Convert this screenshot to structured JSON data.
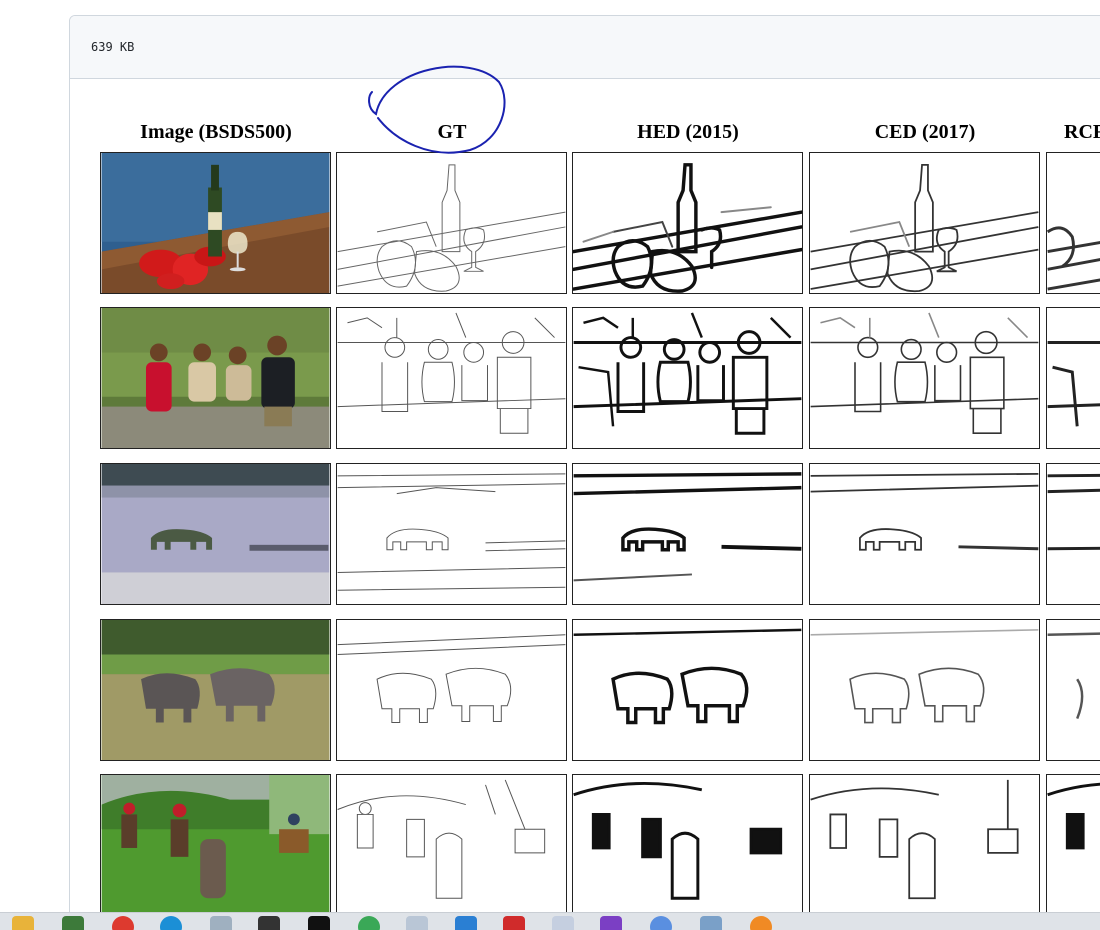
{
  "file": {
    "size_label": "639 KB"
  },
  "figure": {
    "columns": [
      "Image (BSDS500)",
      "GT",
      "HED (2015)",
      "CED (2017)",
      "RCF"
    ],
    "rows": [
      "bottle-lobster",
      "children",
      "polar-bear",
      "rhinos",
      "horse-riders"
    ]
  },
  "annotation": {
    "type": "circle",
    "color": "#1a22b0",
    "target": "GT"
  },
  "taskbar": {
    "icons": [
      "file-explorer-icon",
      "photos-icon",
      "chrome-icon",
      "edge-icon",
      "notepad-icon",
      "terminal-icon",
      "terminal-icon",
      "paint-icon",
      "document-icon",
      "vscode-icon",
      "app-icon",
      "text-editor-icon",
      "visual-studio-icon",
      "globe-icon",
      "mail-icon",
      "location-icon"
    ]
  }
}
